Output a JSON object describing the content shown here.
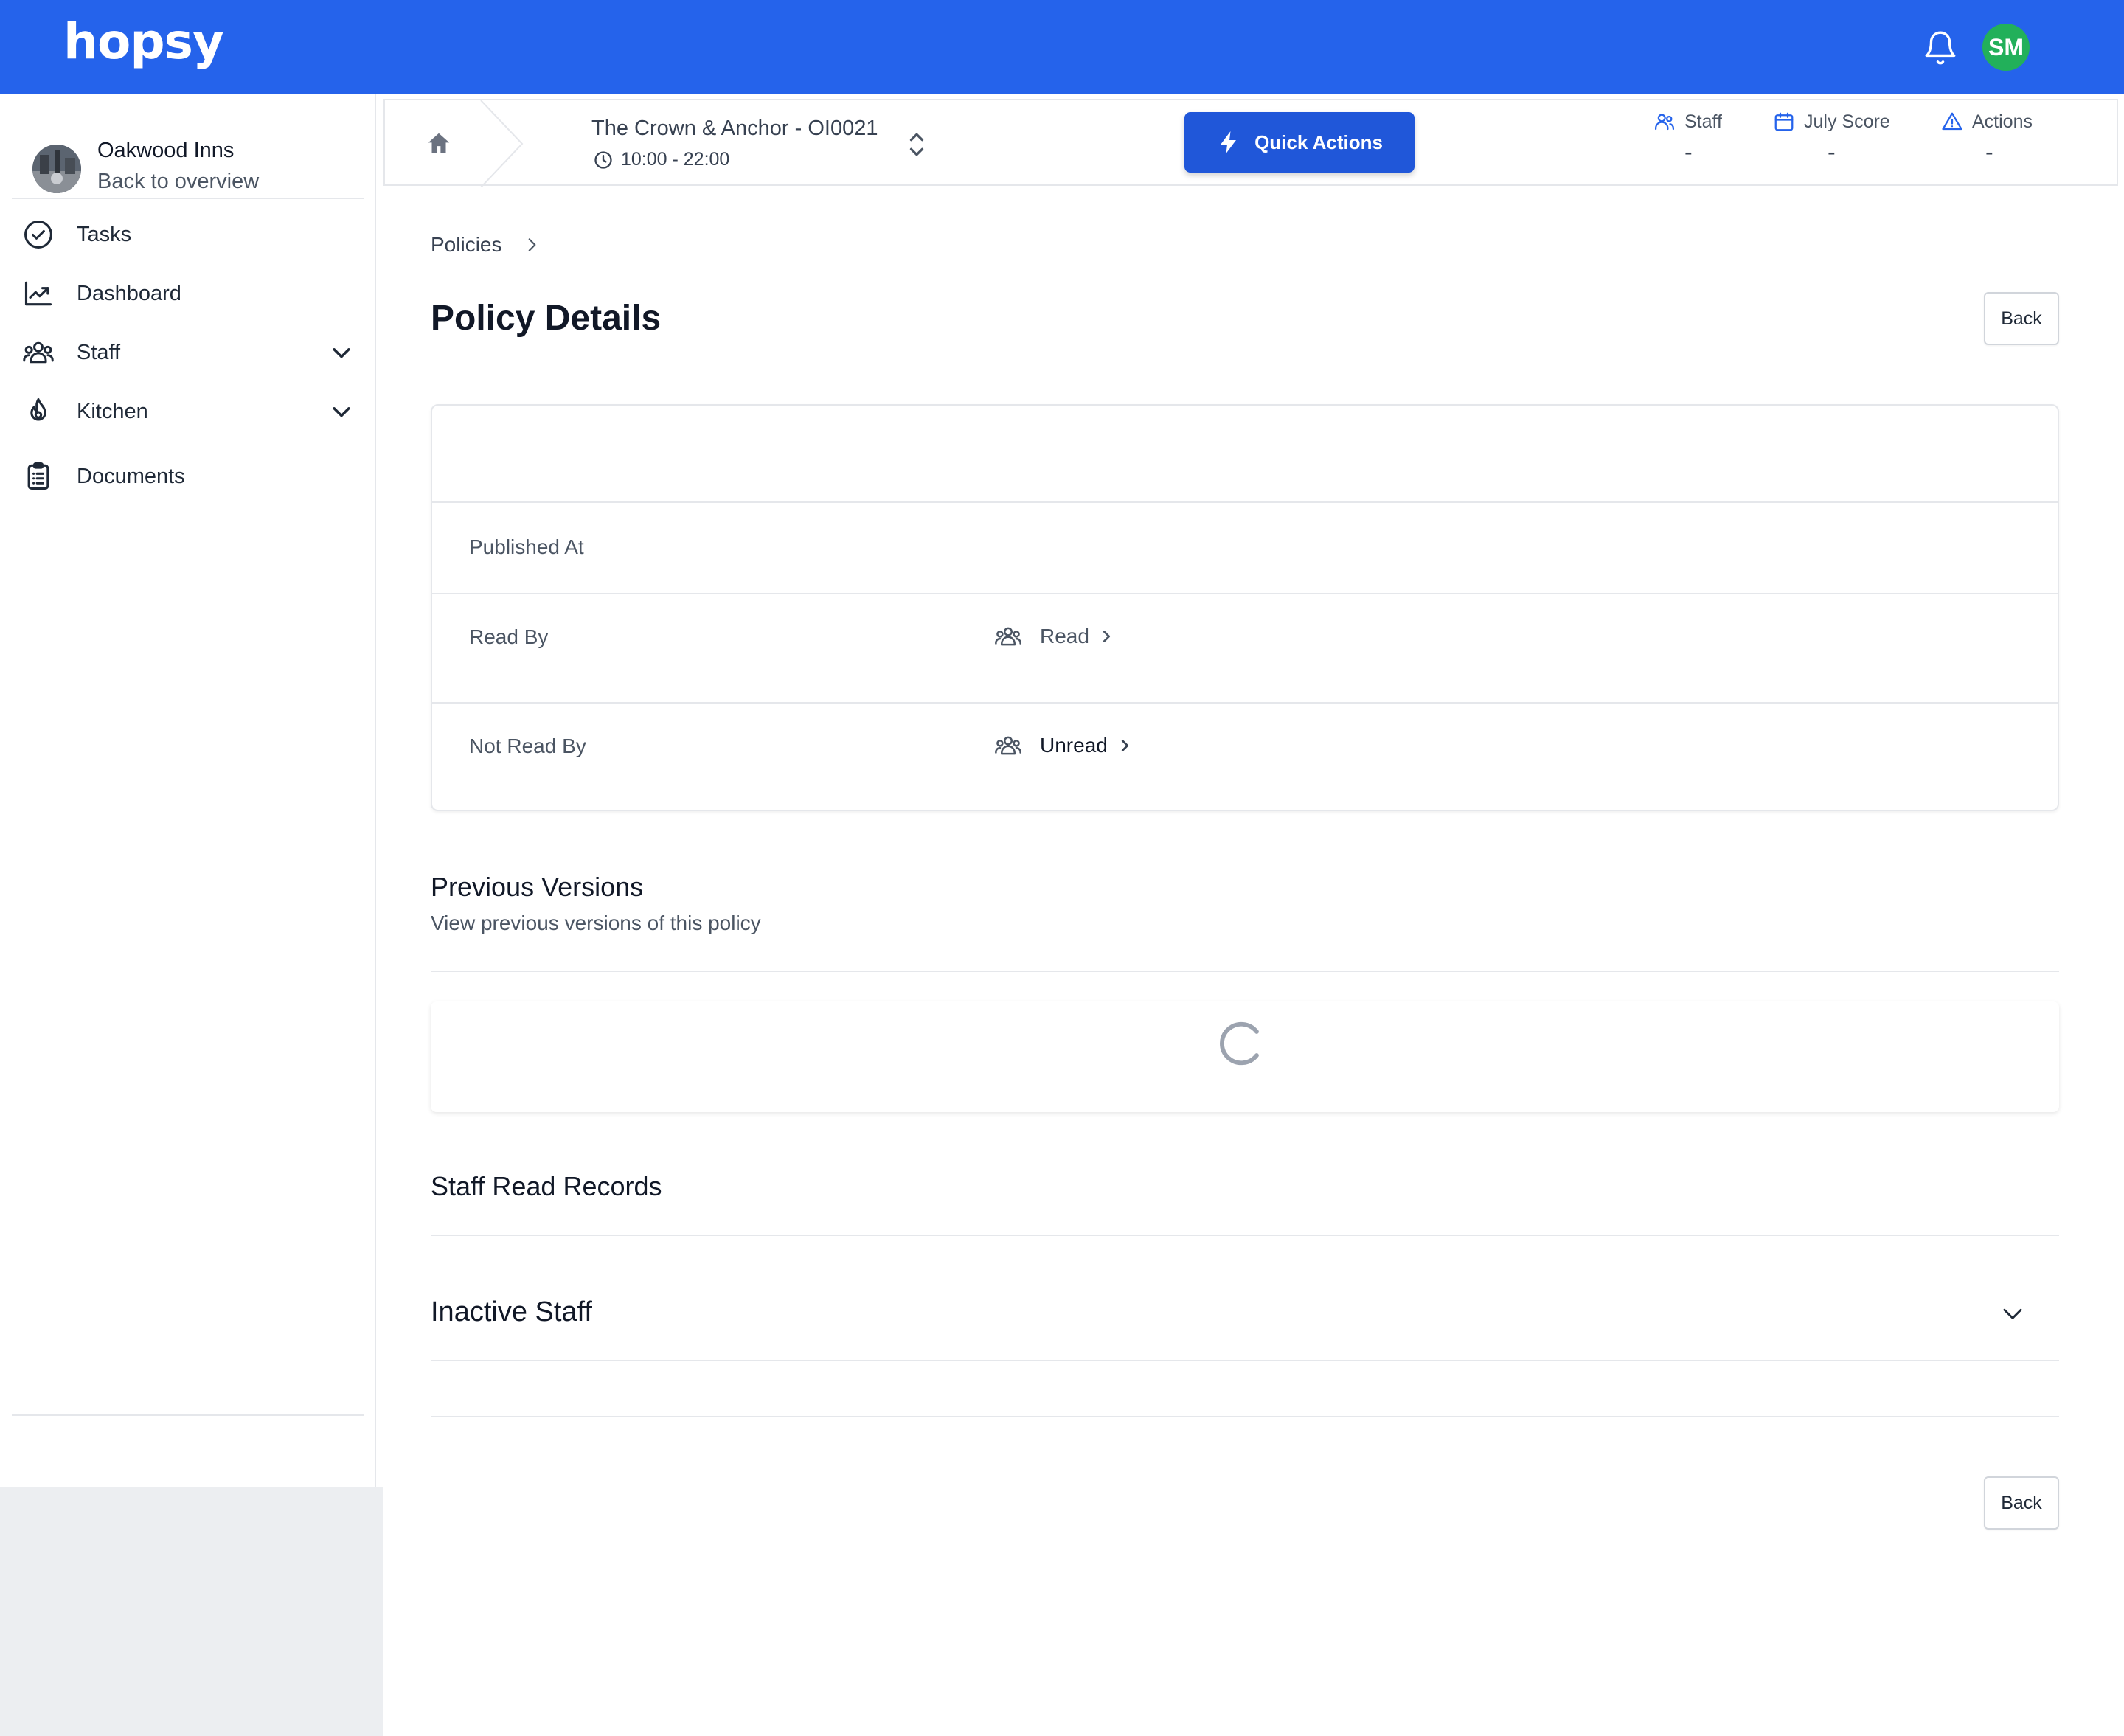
{
  "app": {
    "logo": "hopsy"
  },
  "user": {
    "initials": "SM",
    "avatar_color": "#22b05a"
  },
  "sidebar": {
    "org_name": "Oakwood Inns",
    "back_label": "Back to overview",
    "items": [
      {
        "label": "Tasks",
        "icon": "check-circle-icon"
      },
      {
        "label": "Dashboard",
        "icon": "chart-line-icon"
      },
      {
        "label": "Staff",
        "icon": "users-icon",
        "expandable": true
      },
      {
        "label": "Kitchen",
        "icon": "flame-icon",
        "expandable": true
      },
      {
        "label": "Documents",
        "icon": "clipboard-icon"
      }
    ]
  },
  "location": {
    "name": "The Crown & Anchor - OI0021",
    "hours": "10:00 - 22:00"
  },
  "quick_actions": {
    "label": "Quick Actions"
  },
  "stats": [
    {
      "label": "Staff",
      "value": "-",
      "icon": "users-icon"
    },
    {
      "label": "July Score",
      "value": "-",
      "icon": "calendar-icon"
    },
    {
      "label": "Actions",
      "value": "-",
      "icon": "warning-icon"
    }
  ],
  "breadcrumb": {
    "parent": "Policies"
  },
  "page": {
    "title": "Policy Details",
    "back_label": "Back"
  },
  "details": {
    "published_at_label": "Published At",
    "read_by_label": "Read By",
    "read_link": "Read",
    "not_read_by_label": "Not Read By",
    "unread_link": "Unread"
  },
  "previous_versions": {
    "title": "Previous Versions",
    "subtitle": "View previous versions of this policy"
  },
  "staff_read_records": {
    "title": "Staff Read Records"
  },
  "inactive_staff": {
    "title": "Inactive Staff"
  },
  "colors": {
    "brand": "#2563eb",
    "button_primary": "#2057d9",
    "border": "#e5e7eb"
  }
}
